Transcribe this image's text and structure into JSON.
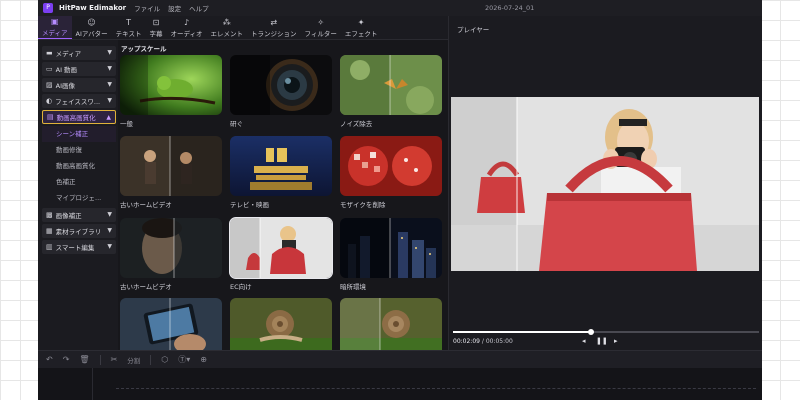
{
  "app": {
    "title": "HitPaw Edimakor",
    "logo_glyph": "P",
    "menu": [
      "ファイル",
      "設定",
      "ヘルプ"
    ],
    "date": "2026-07-24_01"
  },
  "toolbar": {
    "tools": [
      {
        "label": "メディア",
        "icon": "▣",
        "active": true
      },
      {
        "label": "AIアバター",
        "icon": "☺",
        "active": false
      },
      {
        "label": "テキスト",
        "icon": "T",
        "active": false
      },
      {
        "label": "字幕",
        "icon": "⊡",
        "active": false
      },
      {
        "label": "オーディオ",
        "icon": "♪",
        "active": false
      },
      {
        "label": "エレメント",
        "icon": "⁂",
        "active": false
      },
      {
        "label": "トランジション",
        "icon": "⇄",
        "active": false
      },
      {
        "label": "フィルター",
        "icon": "✧",
        "active": false
      },
      {
        "label": "エフェクト",
        "icon": "✦",
        "active": false
      }
    ]
  },
  "sidebar": {
    "items": [
      {
        "label": "メディア",
        "icon": "▬"
      },
      {
        "label": "AI 動画",
        "icon": "▭"
      },
      {
        "label": "AI画像",
        "icon": "▨"
      },
      {
        "label": "フェイススワ...",
        "icon": "◐"
      },
      {
        "label": "動画高画質化",
        "icon": "▤",
        "selected": true
      }
    ],
    "subitems": [
      "シーン補正",
      "動画修復",
      "動画高画質化",
      "色補正",
      "マイプロジェ..."
    ],
    "active_subitem": "シーン補正",
    "items_after": [
      {
        "label": "画像補正",
        "icon": "▩"
      },
      {
        "label": "素材ライブラリ",
        "icon": "▦"
      },
      {
        "label": "スマート編集",
        "icon": "▥"
      }
    ]
  },
  "gallery": {
    "section_title": "アップスケール",
    "cards": [
      {
        "label": "一般"
      },
      {
        "label": "研ぐ"
      },
      {
        "label": "ノイズ除去"
      },
      {
        "label": "古いホームビデオ"
      },
      {
        "label": "テレビ・映画"
      },
      {
        "label": "モザイクを削除"
      },
      {
        "label": "古いホームビデオ"
      },
      {
        "label": "EC向け",
        "selected": true
      },
      {
        "label": "暗所環境"
      },
      {
        "label": ""
      },
      {
        "label": ""
      },
      {
        "label": ""
      }
    ]
  },
  "player": {
    "title": "プレイヤー",
    "current_time": "00:02:09",
    "total_time": "00:05:00",
    "progress": 0.45
  },
  "timeline": {
    "split_label": "分割"
  }
}
